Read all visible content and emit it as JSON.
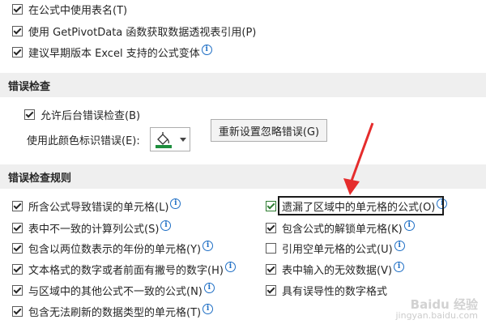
{
  "formula_options": [
    {
      "label": "在公式中使用表名(T)",
      "checked": true
    },
    {
      "label": "使用 GetPivotData 函数获取数据透视表引用(P)",
      "checked": true
    },
    {
      "label": "建议早期版本 Excel 支持的公式变体",
      "checked": true,
      "info": true
    }
  ],
  "error_checking": {
    "heading": "错误检查",
    "enable_background": {
      "label": "允许后台错误检查(B)",
      "checked": true
    },
    "color_label": "使用此颜色标识错误(E):",
    "color_value": "#1e8e3e",
    "reset_button": "重新设置忽略错误(G)"
  },
  "rules": {
    "heading": "错误检查规则",
    "left": [
      {
        "label": "所含公式导致错误的单元格(L)",
        "checked": true
      },
      {
        "label": "表中不一致的计算列公式(S)",
        "checked": true
      },
      {
        "label": "包含以两位数表示的年份的单元格(Y)",
        "checked": true
      },
      {
        "label": "文本格式的数字或者前面有撇号的数字(H)",
        "checked": true
      },
      {
        "label": "与区域中的其他公式不一致的公式(N)",
        "checked": true
      },
      {
        "label": "包含无法刷新的数据类型的单元格(T)",
        "checked": true
      }
    ],
    "right": [
      {
        "label": "遗漏了区域中的单元格的公式(O)",
        "checked": true,
        "highlighted": true
      },
      {
        "label": "包含公式的解锁单元格(K)",
        "checked": true
      },
      {
        "label": "引用空单元格的公式(U)",
        "checked": false
      },
      {
        "label": "表中输入的无效数据(V)",
        "checked": true
      },
      {
        "label": "具有误导性的数字格式",
        "checked": true
      }
    ]
  },
  "annotation_arrow_color": "#e52c2c",
  "watermark": {
    "brand": "Baidu 经验",
    "url": "jingyan.baidu.com"
  }
}
